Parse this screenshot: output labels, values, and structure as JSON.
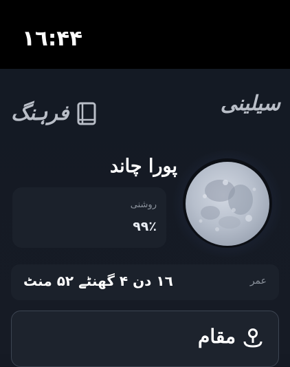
{
  "status_bar": {
    "time": "١٦:۴۴"
  },
  "app": {
    "title": "سیلینی"
  },
  "dictionary": {
    "label": "فرہنگ",
    "icon": "book-icon"
  },
  "moon": {
    "phase_name": "پورا چاند",
    "illumination_label": "روشنی",
    "illumination_value": "۹۹٪",
    "illumination_percent": 99
  },
  "age": {
    "label": "عمر",
    "value": "١٦ دن ۴ گھنٹے ۵۲ منٹ"
  },
  "location": {
    "title": "مقام",
    "icon": "location-pin-icon"
  },
  "colors": {
    "background": "#151a24",
    "card": "#1b212b",
    "accent_text": "#b9bec7"
  }
}
